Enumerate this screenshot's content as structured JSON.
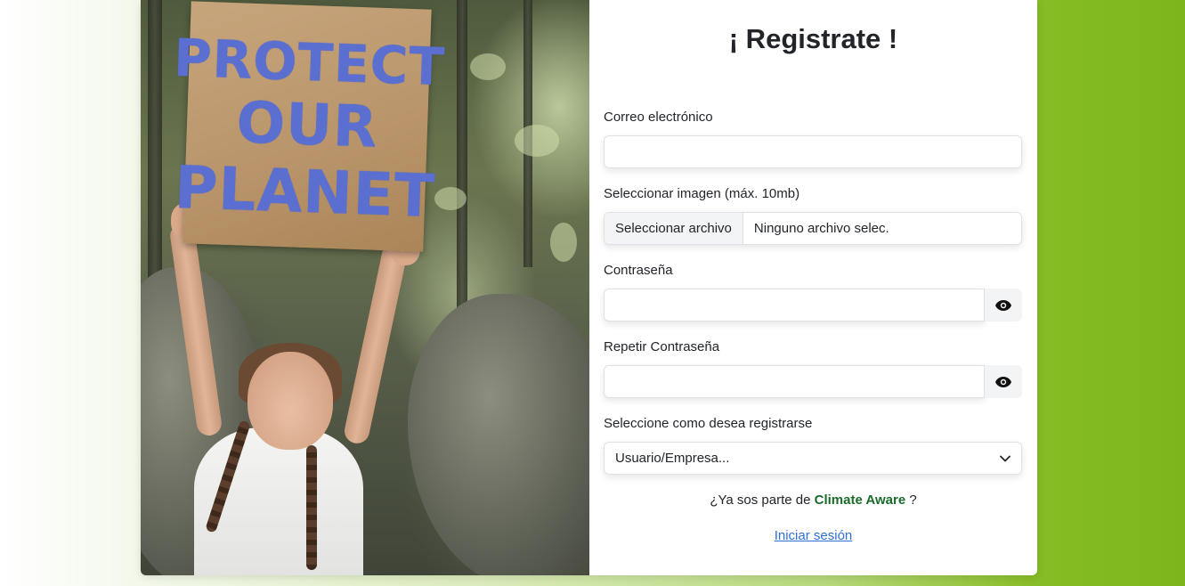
{
  "colors": {
    "brand_green": "#1a6b2a",
    "link_blue": "#2f6fd6",
    "background_gradient_end": "#7cb61c"
  },
  "hero": {
    "sign_lines": [
      "PROTECT",
      "OUR",
      "PLANET"
    ]
  },
  "form": {
    "title": "¡ Registrate !",
    "email": {
      "label": "Correo electrónico",
      "value": "",
      "placeholder": ""
    },
    "image": {
      "label": "Seleccionar imagen (máx. 10mb)",
      "button_label": "Seleccionar archivo",
      "file_status": "Ninguno archivo selec."
    },
    "password": {
      "label": "Contraseña",
      "value": "",
      "toggle_icon": "eye-icon"
    },
    "repeat_password": {
      "label": "Repetir Contraseña",
      "value": "",
      "toggle_icon": "eye-icon"
    },
    "register_type": {
      "label": "Seleccione como desea registrarse",
      "selected": "Usuario/Empresa...",
      "icon": "chevron-down-icon"
    },
    "already_prefix": "¿Ya sos parte de",
    "brand_name": "Climate Aware",
    "already_suffix": "?",
    "login_link": "Iniciar sesión"
  }
}
